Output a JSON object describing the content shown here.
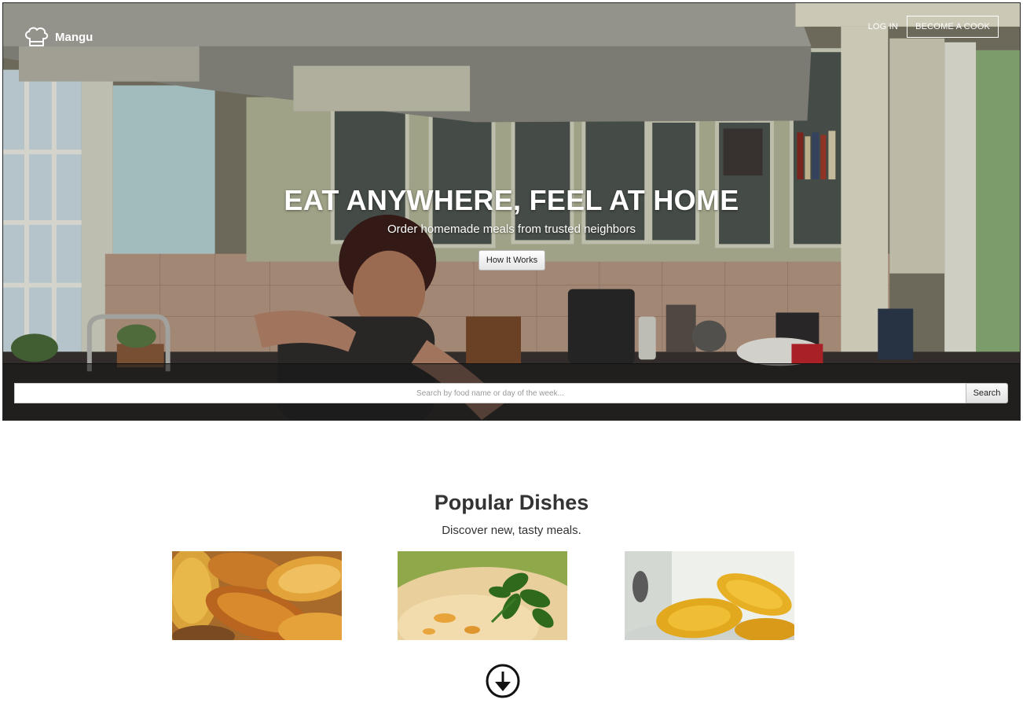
{
  "nav": {
    "brand": "Mangu",
    "brand_icon": "chef-hat-icon",
    "login_label": "LOG IN",
    "become_cook_label": "BECOME A COOK"
  },
  "hero": {
    "headline": "EAT ANYWHERE, FEEL AT HOME",
    "subheadline": "Order homemade meals from trusted neighbors",
    "how_it_works_label": "How It Works"
  },
  "search": {
    "placeholder": "Search by food name or day of the week...",
    "value": "",
    "button_label": "Search"
  },
  "popular": {
    "title": "Popular Dishes",
    "subtitle": "Discover new, tasty meals.",
    "dishes": [
      {
        "image": "fried-plantains-photo"
      },
      {
        "image": "garnished-dish-photo"
      },
      {
        "image": "tostones-photo"
      }
    ]
  },
  "scroll": {
    "icon": "arrow-down-circle-icon"
  },
  "colors": {
    "hero_text": "#ffffff",
    "body_text": "#333333",
    "search_band": "#141414"
  }
}
